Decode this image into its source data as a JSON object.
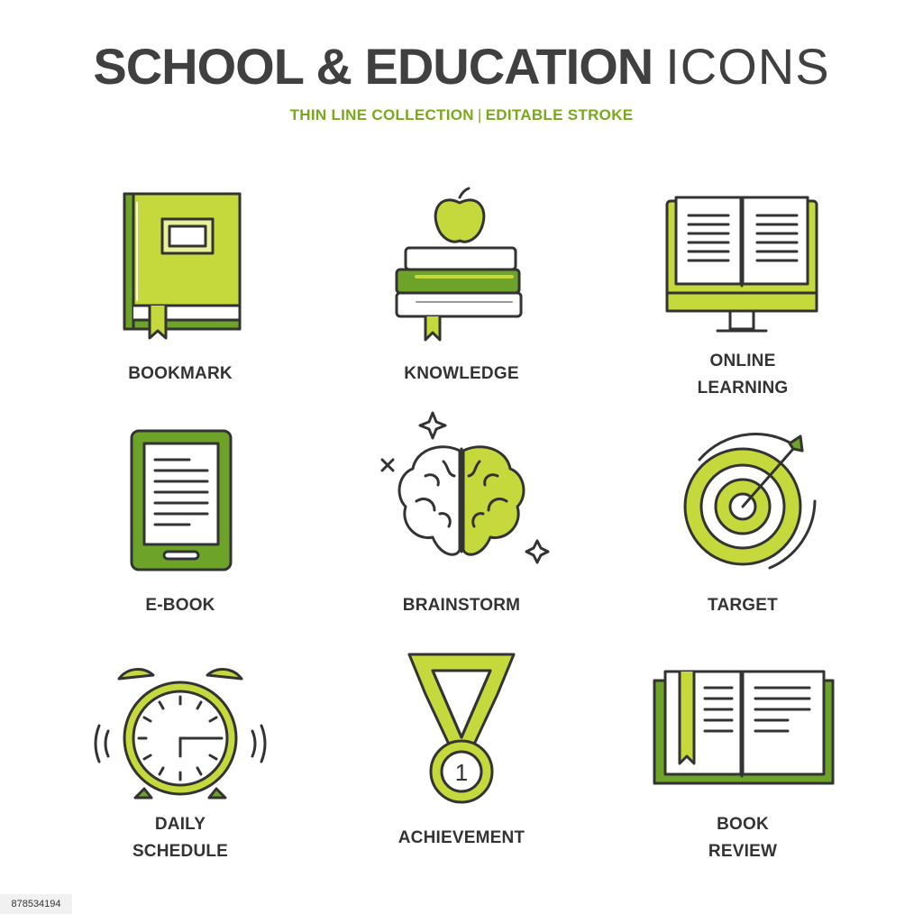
{
  "header": {
    "title_bold": "SCHOOL & EDUCATION",
    "title_thin": "ICONS",
    "subtitle_left": "THIN LINE COLLECTION",
    "subtitle_sep": "|",
    "subtitle_right": "EDITABLE STROKE"
  },
  "colors": {
    "accent_light": "#c6d93c",
    "accent_dark": "#6ea32a",
    "stroke": "#333333",
    "title": "#404040",
    "subtitle": "#7aa81b"
  },
  "icons": [
    {
      "name": "bookmark",
      "icon": "book-bookmark-icon",
      "label": "BOOKMARK"
    },
    {
      "name": "knowledge",
      "icon": "books-apple-icon",
      "label": "KNOWLEDGE"
    },
    {
      "name": "online-learning",
      "icon": "monitor-book-icon",
      "label_1": "ONLINE",
      "label_2": "LEARNING"
    },
    {
      "name": "e-book",
      "icon": "tablet-reader-icon",
      "label": "E-BOOK"
    },
    {
      "name": "brainstorm",
      "icon": "brain-icon",
      "label": "BRAINSTORM"
    },
    {
      "name": "target",
      "icon": "target-arrow-icon",
      "label": "TARGET"
    },
    {
      "name": "daily-schedule",
      "icon": "alarm-clock-icon",
      "label_1": "DAILY",
      "label_2": "SCHEDULE"
    },
    {
      "name": "achievement",
      "icon": "medal-icon",
      "label": "ACHIEVEMENT",
      "medal_number": "1"
    },
    {
      "name": "book-review",
      "icon": "open-book-review-icon",
      "label_1": "BOOK",
      "label_2": "REVIEW"
    }
  ],
  "footer": {
    "image_id": "878534194"
  }
}
